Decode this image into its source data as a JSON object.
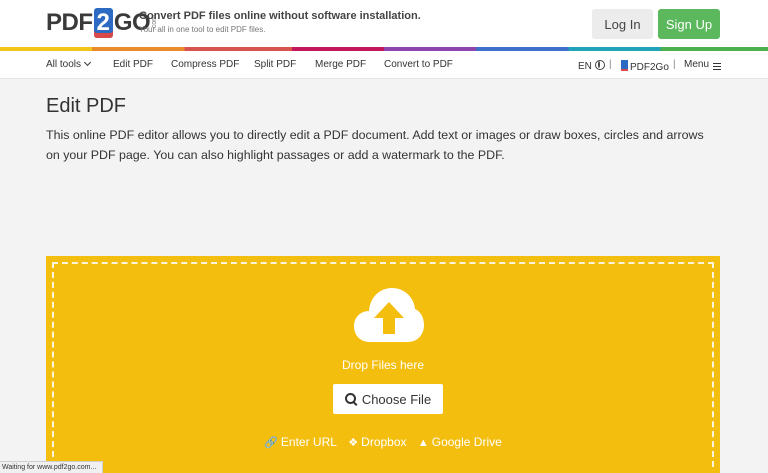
{
  "header": {
    "logo": {
      "pdf": "PDF",
      "two": "2",
      "go": "GO",
      "com": ".com"
    },
    "tagline_main": "Convert PDF files online without software installation.",
    "tagline_sub": "Your all in one tool to edit PDF files.",
    "login_label": "Log In",
    "signup_label": "Sign Up"
  },
  "nav": {
    "all_tools": "All tools",
    "items": [
      "Edit PDF",
      "Compress PDF",
      "Split PDF",
      "Merge PDF",
      "Convert to PDF"
    ],
    "language": "EN",
    "brand": "PDF2Go",
    "menu": "Menu",
    "separator": "|"
  },
  "page": {
    "title": "Edit PDF",
    "description": "This online PDF editor allows you to directly edit a PDF document. Add text or images or draw boxes, circles and arrows on your PDF page. You can also highlight passages or add a watermark to the PDF."
  },
  "upload": {
    "drop_text": "Drop Files here",
    "choose_label": "Choose File",
    "links": [
      "Enter URL",
      "Dropbox",
      "Google Drive"
    ],
    "icons": [
      "cloud-upload-icon",
      "search-icon",
      "link-icon",
      "dropbox-icon",
      "google-drive-icon"
    ]
  },
  "status_bar": "Waiting for www.pdf2go.com...",
  "colors": {
    "upload_bg": "#f4be0e",
    "signup_bg": "#5cb85c",
    "page_bg": "#f3f3f3"
  }
}
